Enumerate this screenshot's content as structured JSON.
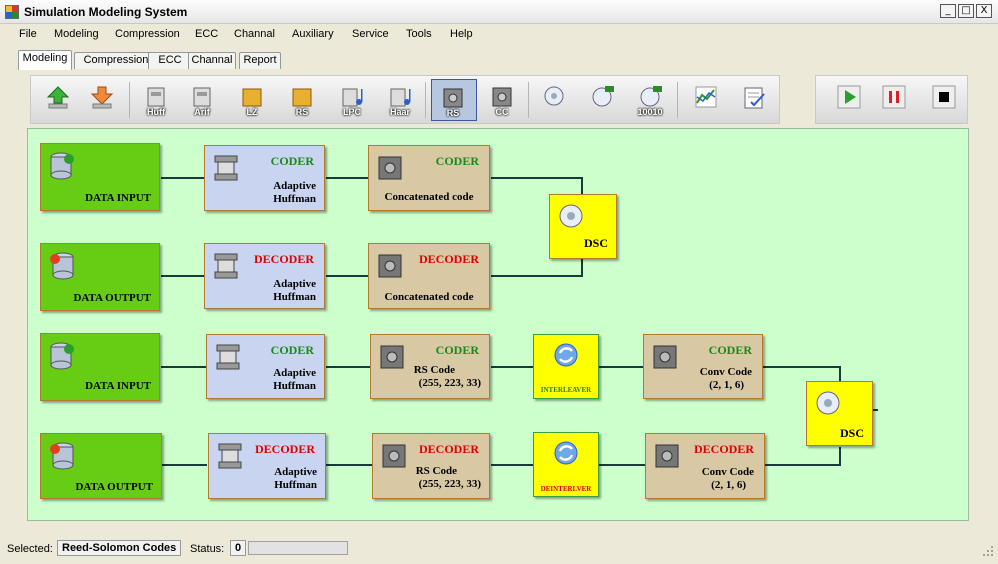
{
  "window": {
    "title": "Simulation Modeling System",
    "btn_min": "_",
    "btn_max": "□",
    "btn_close": "X"
  },
  "menu": [
    "File",
    "Modeling",
    "Compression",
    "ECC",
    "Channal",
    "Auxiliary",
    "Service",
    "Tools",
    "Help"
  ],
  "tabs": [
    "Modeling",
    "Compression",
    "ECC",
    "Channal",
    "Report"
  ],
  "active_tab": "Modeling",
  "toolbar": {
    "huff": "Huff",
    "arif": "Arif",
    "lz": "LZ",
    "rs": "RS",
    "lpc": "LPC",
    "haar": "Haar",
    "rs_ecc": "RS",
    "cc": "CC",
    "channel_10010": "10010"
  },
  "blocks": {
    "row1_input": "DATA INPUT",
    "row1_coder_head": "CODER",
    "row1_coder_l1": "Adaptive",
    "row1_coder_l2": "Huffman",
    "row1_cc_head": "CODER",
    "row1_cc_text": "Concatenated code",
    "dsc1": "DSC",
    "row2_output": "DATA OUTPUT",
    "row2_decoder_head": "DECODER",
    "row2_decoder_l1": "Adaptive",
    "row2_decoder_l2": "Huffman",
    "row2_cc_head": "DECODER",
    "row2_cc_text": "Concatenated code",
    "row3_input": "DATA INPUT",
    "row3_coder_head": "CODER",
    "row3_coder_l1": "Adaptive",
    "row3_coder_l2": "Huffman",
    "row3_rs_head": "CODER",
    "row3_rs_l1": "RS Code",
    "row3_rs_l2": "(255, 223, 33)",
    "interleaver": "INTERLEAVER",
    "row3_conv_head": "CODER",
    "row3_conv_l1": "Conv Code",
    "row3_conv_l2": "(2, 1, 6)",
    "dsc2": "DSC",
    "row4_output": "DATA OUTPUT",
    "row4_decoder_head": "DECODER",
    "row4_decoder_l1": "Adaptive",
    "row4_decoder_l2": "Huffman",
    "row4_rs_head": "DECODER",
    "row4_rs_l1": "RS Code",
    "row4_rs_l2": "(255, 223, 33)",
    "deinterleaver": "DEINTERLVER",
    "row4_conv_head": "DECODER",
    "row4_conv_l1": "Conv Code",
    "row4_conv_l2": "(2, 1, 6)"
  },
  "status": {
    "selected_label": "Selected:",
    "selected_value": "Reed-Solomon Codes",
    "status_label": "Status:",
    "status_value": "0",
    "progress": 0
  },
  "colors": {
    "canvas": "#ccffcc",
    "io_block": "#66cc14",
    "huffman_block": "#c8d4f0",
    "ecc_block": "#d8c8a4",
    "dsc_block": "#ffff00",
    "coder_text": "#1a8a1a",
    "decoder_text": "#e00000"
  }
}
